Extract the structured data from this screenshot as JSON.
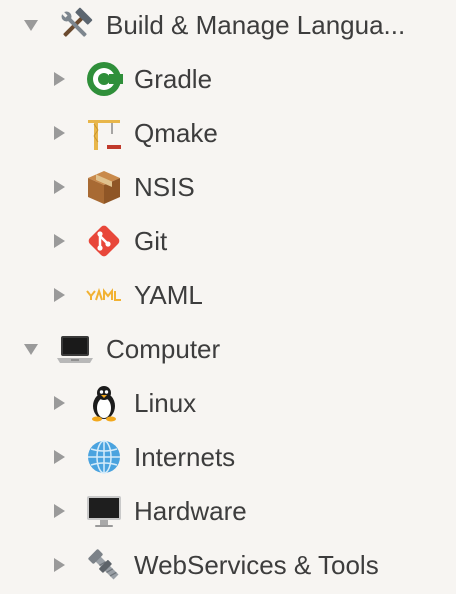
{
  "tree": [
    {
      "label": "Build & Manage Langua...",
      "icon": "hammer-and-wrench-icon",
      "expanded": true,
      "level": 0
    },
    {
      "label": "Gradle",
      "icon": "gradle-icon",
      "expanded": false,
      "level": 1
    },
    {
      "label": "Qmake",
      "icon": "crane-icon",
      "expanded": false,
      "level": 1
    },
    {
      "label": "NSIS",
      "icon": "package-box-icon",
      "expanded": false,
      "level": 1
    },
    {
      "label": "Git",
      "icon": "git-icon",
      "expanded": false,
      "level": 1
    },
    {
      "label": "YAML",
      "icon": "yaml-icon",
      "expanded": false,
      "level": 1
    },
    {
      "label": "Computer",
      "icon": "laptop-icon",
      "expanded": true,
      "level": 0
    },
    {
      "label": "Linux",
      "icon": "penguin-icon",
      "expanded": false,
      "level": 1
    },
    {
      "label": "Internets",
      "icon": "globe-icon",
      "expanded": false,
      "level": 1
    },
    {
      "label": "Hardware",
      "icon": "desktop-computer-icon",
      "expanded": false,
      "level": 1
    },
    {
      "label": "WebServices & Tools",
      "icon": "nut-and-bolt-icon",
      "expanded": false,
      "level": 1
    }
  ],
  "colors": {
    "background": "#f7f5f2",
    "text": "#3d3d3d",
    "disclosure": "#9a9a9a"
  }
}
